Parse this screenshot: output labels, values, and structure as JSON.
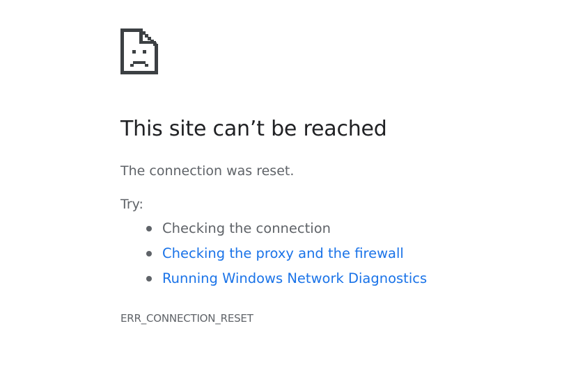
{
  "error_page": {
    "icon": "sad-document-icon",
    "title": "This site can’t be reached",
    "summary": "The connection was reset.",
    "try_label": "Try:",
    "suggestions": [
      {
        "text": "Checking the connection",
        "is_link": false
      },
      {
        "text": "Checking the proxy and the firewall",
        "is_link": true
      },
      {
        "text": "Running Windows Network Diagnostics",
        "is_link": true
      }
    ],
    "error_code": "ERR_CONNECTION_RESET"
  },
  "colors": {
    "title": "#202124",
    "body_text": "#5f6368",
    "link": "#1a73e8",
    "icon": "#3c4043"
  }
}
